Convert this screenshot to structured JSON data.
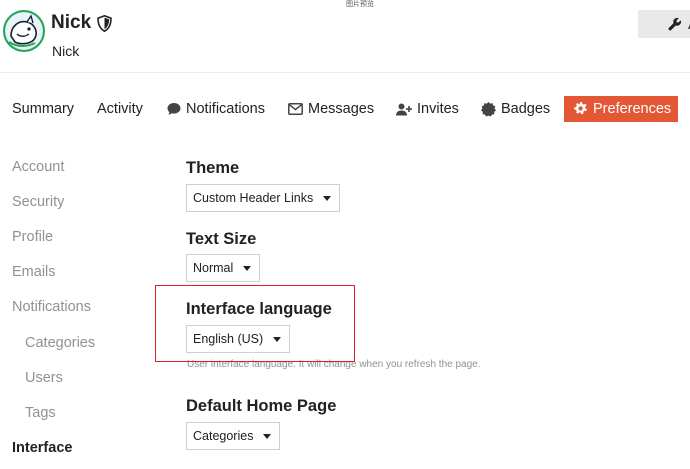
{
  "caption": "图片预览",
  "user": {
    "name": "Nick",
    "username": "Nick"
  },
  "admin_button": {
    "label": "A",
    "icon": "wrench-icon"
  },
  "nav": {
    "items": [
      {
        "label": "Summary",
        "icon": ""
      },
      {
        "label": "Activity",
        "icon": ""
      },
      {
        "label": "Notifications",
        "icon": "speech-bubble-icon"
      },
      {
        "label": "Messages",
        "icon": "envelope-icon"
      },
      {
        "label": "Invites",
        "icon": "user-plus-icon"
      },
      {
        "label": "Badges",
        "icon": "badge-certificate-icon"
      },
      {
        "label": "Preferences",
        "icon": "gear-icon",
        "active": true
      }
    ]
  },
  "sidebar": {
    "items": [
      {
        "label": "Account"
      },
      {
        "label": "Security"
      },
      {
        "label": "Profile"
      },
      {
        "label": "Emails"
      },
      {
        "label": "Notifications"
      },
      {
        "label": "Categories"
      },
      {
        "label": "Users"
      },
      {
        "label": "Tags"
      },
      {
        "label": "Interface"
      }
    ]
  },
  "settings": {
    "theme": {
      "title": "Theme",
      "value": "Custom Header Links"
    },
    "text_size": {
      "title": "Text Size",
      "value": "Normal"
    },
    "interface_language": {
      "title": "Interface language",
      "value": "English (US)",
      "helper": "User interface language. It will change when you refresh the page."
    },
    "default_home_page": {
      "title": "Default Home Page",
      "value": "Categories"
    }
  },
  "colors": {
    "accent": "#e45735",
    "highlight": "#e02020",
    "muted_text": "#919191"
  }
}
